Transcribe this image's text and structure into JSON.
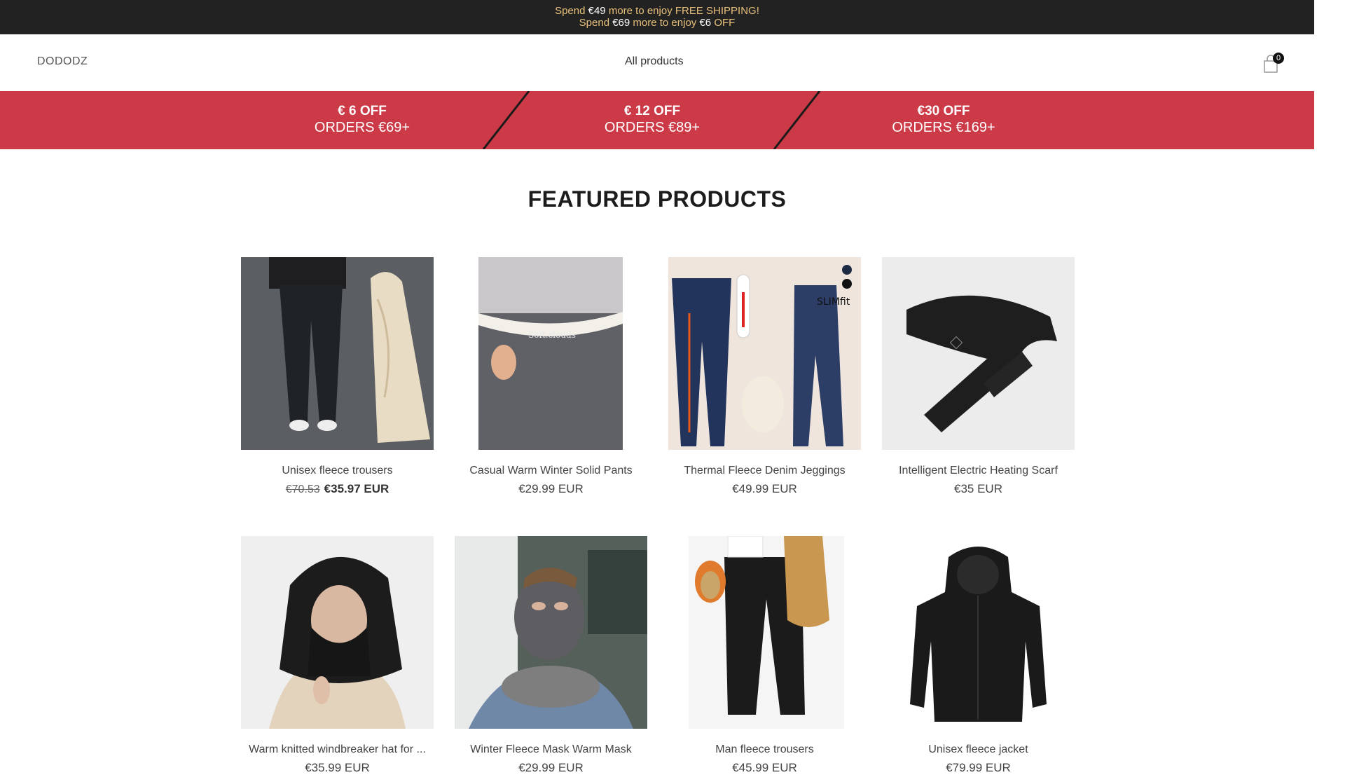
{
  "announcement": {
    "line1": {
      "pre": "Spend ",
      "amount": "€49",
      "post": " more to enjoy FREE SHIPPING!"
    },
    "line2": {
      "pre": "Spend ",
      "amount": "€69",
      "mid": " more to enjoy ",
      "amount2": "€6",
      "post": " OFF"
    }
  },
  "header": {
    "logo": "DODODZ",
    "nav_all": "All products",
    "cart_count": "0"
  },
  "promo": {
    "tiers": [
      {
        "line1": "€ 6 OFF",
        "line2": "ORDERS €69+"
      },
      {
        "line1": "€ 12 OFF",
        "line2": "ORDERS €89+"
      },
      {
        "line1": "€30 OFF",
        "line2": "ORDERS €169+"
      }
    ]
  },
  "section_title": "FEATURED PRODUCTS",
  "products": [
    {
      "name": "Unisex fleece trousers",
      "price_old": "€70.53",
      "price": "€35.97 EUR"
    },
    {
      "name": "Casual Warm Winter Solid Pants",
      "price": "€29.99 EUR"
    },
    {
      "name": "Thermal Fleece Denim Jeggings",
      "price": "€49.99 EUR"
    },
    {
      "name": "Intelligent Electric Heating Scarf",
      "price": "€35 EUR"
    },
    {
      "name": "Warm knitted windbreaker hat for ...",
      "price": "€35.99 EUR"
    },
    {
      "name": "Winter Fleece Mask Warm Mask",
      "price": "€29.99 EUR"
    },
    {
      "name": "Man fleece trousers",
      "price": "€45.99 EUR"
    },
    {
      "name": "Unisex fleece jacket",
      "price": "€79.99 EUR"
    }
  ],
  "colors": {
    "announce_bg": "#222222",
    "announce_text": "#e8c07a",
    "promo_bg": "#cb3a46"
  },
  "icons": {
    "cart": "shopping-bag-icon"
  }
}
